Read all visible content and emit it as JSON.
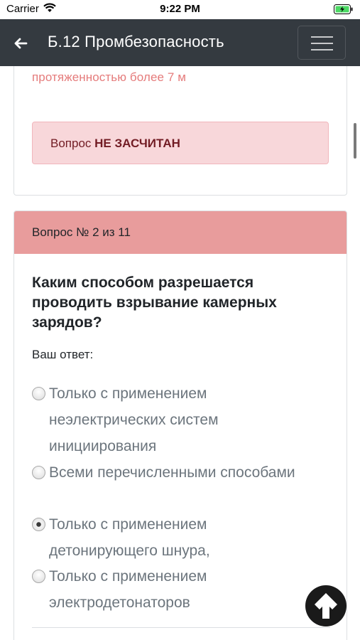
{
  "status_bar": {
    "carrier": "Carrier",
    "time": "9:22 PM"
  },
  "navbar": {
    "title": "Б.12 Промбезопасность"
  },
  "prev_question": {
    "tail_text": "протяженностью более 7 м",
    "result_prefix": "Вопрос",
    "result_status": "НЕ ЗАСЧИТАН"
  },
  "question_card": {
    "header": "Вопрос № 2 из 11",
    "question": "Каким способом разрешается проводить взрывание камерных зарядов?",
    "your_answer_label": "Ваш ответ:",
    "options": [
      {
        "text": "Только с применением неэлектрических систем инициирования",
        "checked": false
      },
      {
        "text": "Всеми перечисленными способами",
        "checked": false
      },
      {
        "text": "Только с применением детонирующего шнура,",
        "checked": true
      },
      {
        "text": "Только с применением электродетонаторов",
        "checked": false
      }
    ]
  },
  "colors": {
    "navbar": "#343a40",
    "card_header": "#e89c9c",
    "alert_bg": "#f8d7da",
    "alert_text": "#721c24",
    "prev_text": "#e57b7b"
  },
  "icons": {
    "back": "arrow-left-icon",
    "menu": "hamburger-icon",
    "scroll_top": "arrow-up-icon",
    "wifi": "wifi-icon",
    "battery": "battery-charging-icon"
  }
}
